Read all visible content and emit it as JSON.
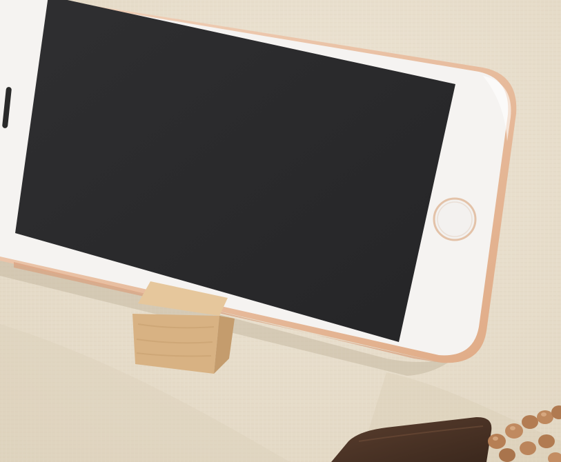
{
  "scene": {
    "description_visible_text": "",
    "colors": {
      "cloth": "#ebe2d1",
      "cloth_shadow": "#d9cdb7",
      "phone_body": "#f4f2f0",
      "phone_rim": "#e7b998",
      "screen": "#2b2b2d",
      "wood_block_top": "#e2bf93",
      "wood_block_front": "#d6ae7e",
      "wood_block_side": "#c39a6b",
      "dark_wood": "#4a3326",
      "beads": "#b9835a"
    },
    "objects": [
      "phone",
      "wooden-cube-stand",
      "dark-wood-block",
      "bead-string"
    ]
  }
}
